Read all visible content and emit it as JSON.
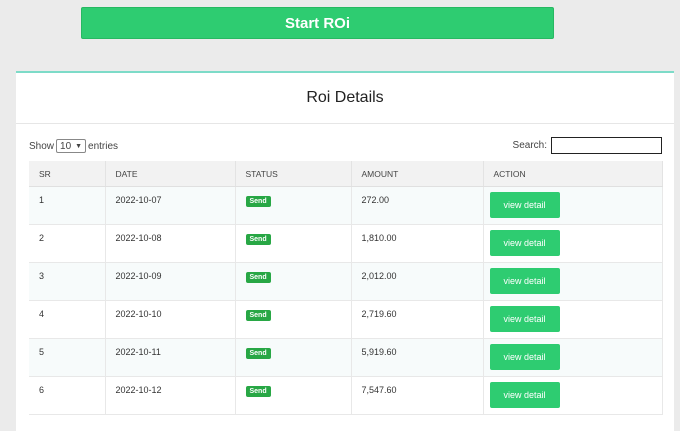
{
  "start_button": {
    "label": "Start ROi"
  },
  "card": {
    "title": "Roi Details"
  },
  "controls": {
    "show_label": "Show",
    "entries_value": "10",
    "entries_label": "entries",
    "search_label": "Search:",
    "search_value": ""
  },
  "table": {
    "headers": [
      "SR",
      "DATE",
      "STATUS",
      "AMOUNT",
      "ACTION"
    ],
    "rows": [
      {
        "sr": "1",
        "date": "2022-10-07",
        "status": "Send",
        "amount": "272.00",
        "action": "view detail"
      },
      {
        "sr": "2",
        "date": "2022-10-08",
        "status": "Send",
        "amount": "1,810.00",
        "action": "view detail"
      },
      {
        "sr": "3",
        "date": "2022-10-09",
        "status": "Send",
        "amount": "2,012.00",
        "action": "view detail"
      },
      {
        "sr": "4",
        "date": "2022-10-10",
        "status": "Send",
        "amount": "2,719.60",
        "action": "view detail"
      },
      {
        "sr": "5",
        "date": "2022-10-11",
        "status": "Send",
        "amount": "5,919.60",
        "action": "view detail"
      },
      {
        "sr": "6",
        "date": "2022-10-12",
        "status": "Send",
        "amount": "7,547.60",
        "action": "view detail"
      }
    ]
  },
  "colors": {
    "accent_green": "#2ecc71",
    "badge_green": "#28a745",
    "card_top_border": "#7ddbc8"
  }
}
